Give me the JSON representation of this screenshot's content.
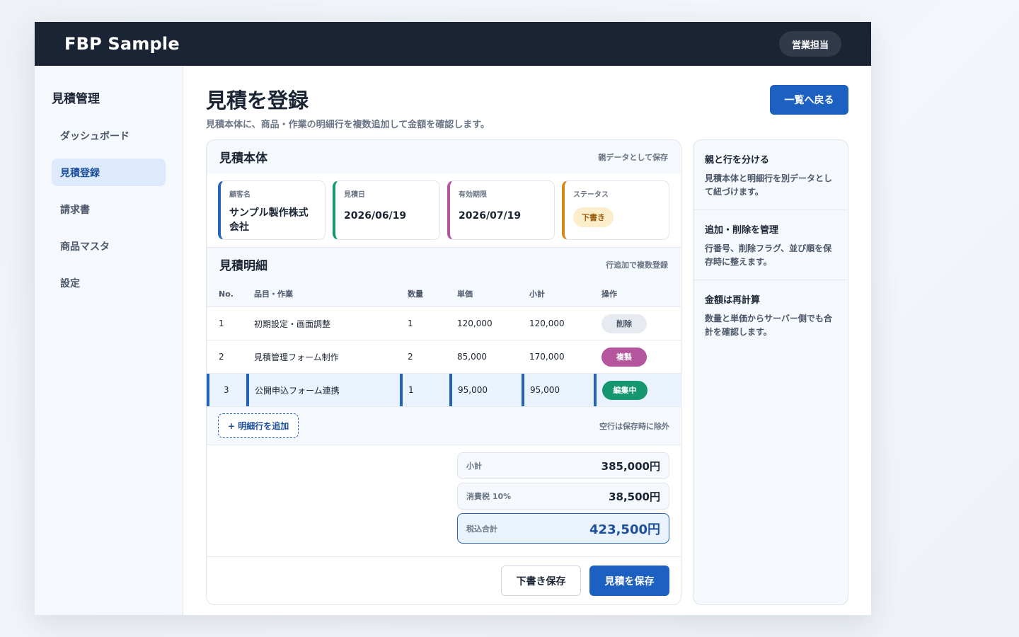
{
  "app": {
    "brand": "FBP Sample",
    "role": "営業担当"
  },
  "sidebar": {
    "title": "見積管理",
    "items": [
      {
        "label": "ダッシュボード",
        "active": false
      },
      {
        "label": "見積登録",
        "active": true
      },
      {
        "label": "請求書",
        "active": false
      },
      {
        "label": "商品マスタ",
        "active": false
      },
      {
        "label": "設定",
        "active": false
      }
    ]
  },
  "page": {
    "title": "見積を登録",
    "subtitle": "見積本体に、商品・作業の明細行を複数追加して金額を確認します。",
    "back_label": "一覧へ戻る"
  },
  "header_section": {
    "title": "見積本体",
    "note": "親データとして保存",
    "fields": [
      {
        "label": "顧客名",
        "value": "サンプル製作株式会社"
      },
      {
        "label": "見積日",
        "value": "2026/06/19"
      },
      {
        "label": "有効期限",
        "value": "2026/07/19"
      },
      {
        "label": "ステータス",
        "value": "下書き"
      }
    ]
  },
  "lines_section": {
    "title": "見積明細",
    "note": "行追加で複数登録",
    "columns": [
      "No.",
      "品目・作業",
      "数量",
      "単価",
      "小計",
      "操作"
    ],
    "rows": [
      {
        "no": "1",
        "item": "初期設定・画面調整",
        "qty": "1",
        "price": "120,000",
        "subtotal": "120,000",
        "action": "削除"
      },
      {
        "no": "2",
        "item": "見積管理フォーム制作",
        "qty": "2",
        "price": "85,000",
        "subtotal": "170,000",
        "action": "複製"
      },
      {
        "no": "3",
        "item": "公開申込フォーム連携",
        "qty": "1",
        "price": "95,000",
        "subtotal": "95,000",
        "action": "編集中"
      }
    ],
    "add_label": "+ 明細行を追加",
    "add_note": "空行は保存時に除外"
  },
  "totals": {
    "subtotal_label": "小計",
    "subtotal": "385,000円",
    "tax_label": "消費税 10%",
    "tax": "38,500円",
    "grand_label": "税込合計",
    "grand": "423,500円"
  },
  "actions": {
    "draft": "下書き保存",
    "save": "見積を保存"
  },
  "tips": [
    {
      "title": "親と行を分ける",
      "text": "見積本体と明細行を別データとして紐づけます。"
    },
    {
      "title": "追加・削除を管理",
      "text": "行番号、削除フラグ、並び順を保存時に整えます。"
    },
    {
      "title": "金額は再計算",
      "text": "数量と単価からサーバー側でも合計を確認します。"
    }
  ],
  "colors": {
    "accent": "#1c60c2",
    "topbar": "#1b2434",
    "green": "#14976f",
    "purple": "#b5559e",
    "orange": "#d4881c"
  }
}
